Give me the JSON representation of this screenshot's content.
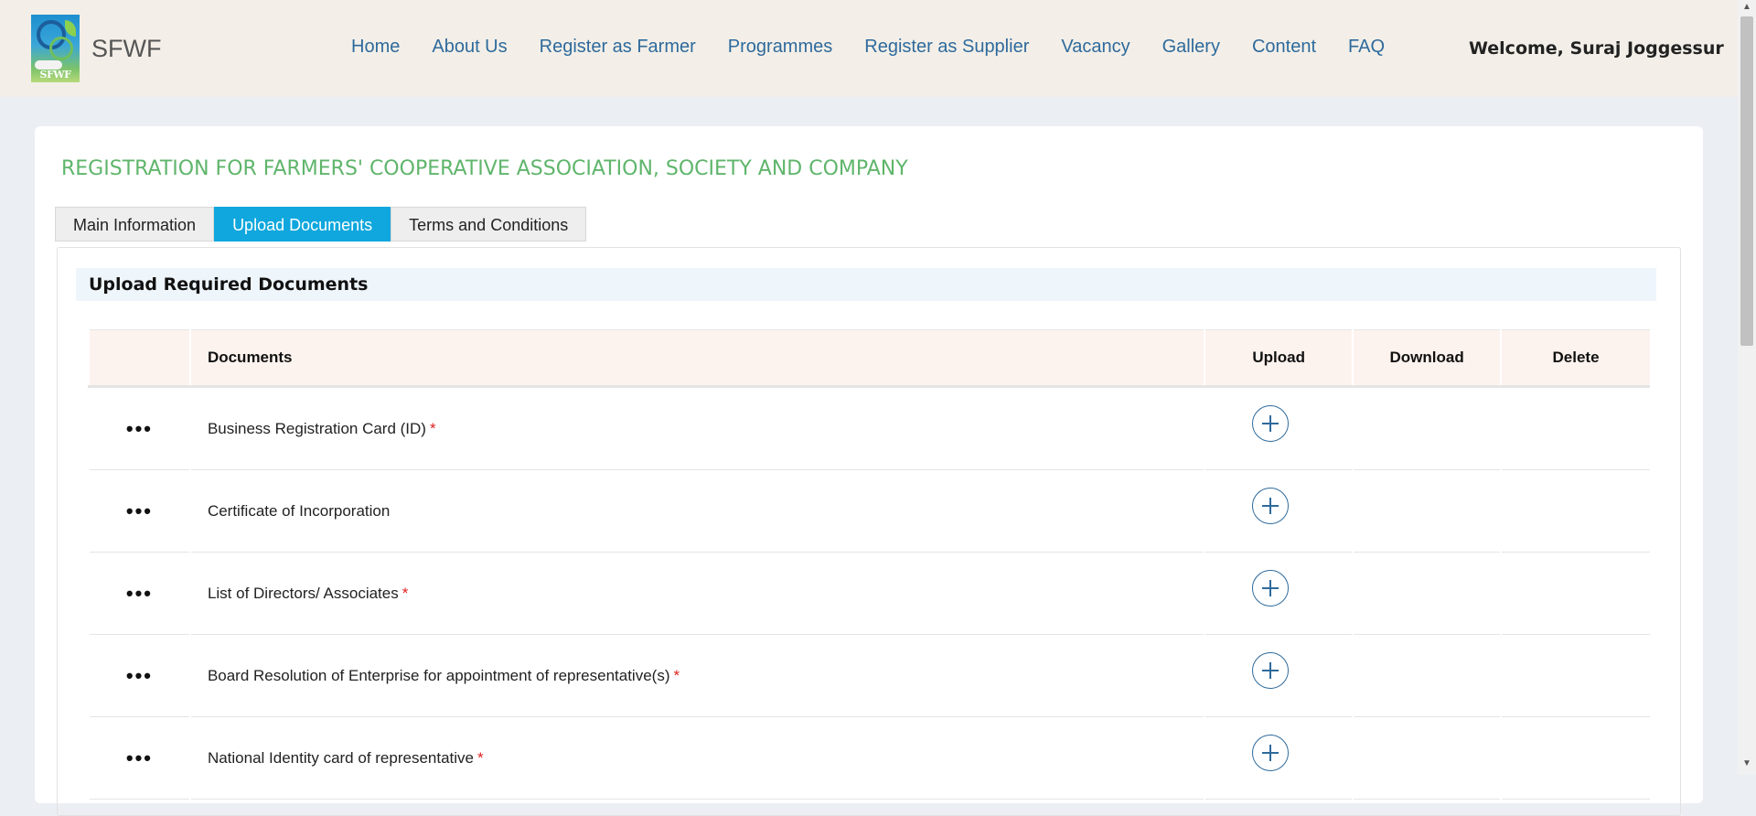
{
  "header": {
    "logo_text": "SFWF",
    "brand": "SFWF",
    "nav": [
      "Home",
      "About Us",
      "Register as Farmer",
      "Programmes",
      "Register as Supplier",
      "Vacancy",
      "Gallery",
      "Content",
      "FAQ"
    ],
    "welcome": "Welcome, Suraj Joggessur"
  },
  "page": {
    "title": "REGISTRATION FOR FARMERS' COOPERATIVE ASSOCIATION, SOCIETY AND COMPANY",
    "tabs": [
      {
        "label": "Main Information",
        "active": false
      },
      {
        "label": "Upload Documents",
        "active": true
      },
      {
        "label": "Terms and Conditions",
        "active": false
      }
    ],
    "section_title": "Upload Required Documents"
  },
  "table": {
    "headers": {
      "documents": "Documents",
      "upload": "Upload",
      "download": "Download",
      "delete": "Delete"
    },
    "menu_glyph": "•••",
    "required_mark": "*",
    "rows": [
      {
        "name": "Business Registration Card (ID)",
        "required": true
      },
      {
        "name": "Certificate of Incorporation",
        "required": false
      },
      {
        "name": "List of Directors/ Associates",
        "required": true
      },
      {
        "name": "Board Resolution of Enterprise for appointment of representative(s)",
        "required": true
      },
      {
        "name": "National Identity card of representative",
        "required": true
      }
    ]
  },
  "colors": {
    "accent_tab": "#0fa7dd",
    "title_green": "#5fb56b",
    "nav_link": "#2e6a9c",
    "required": "#e02020"
  },
  "icons": {
    "row_menu": "more-horizontal-icon",
    "upload": "plus-circle-icon"
  }
}
